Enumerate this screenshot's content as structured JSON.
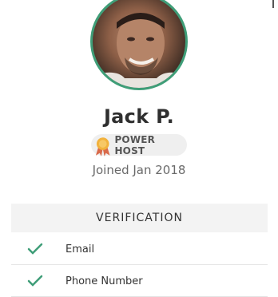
{
  "profile": {
    "name": "Jack P.",
    "badge": "POWER HOST",
    "joined": "Joined Jan 2018"
  },
  "verification": {
    "title": "VERIFICATION",
    "items": [
      {
        "label": "Email",
        "icon": "check-icon"
      },
      {
        "label": "Phone Number",
        "icon": "check-icon"
      }
    ]
  },
  "colors": {
    "accent": "#3f9e78",
    "badge_bg": "#efefef",
    "header_bg": "#f3f3f3"
  }
}
